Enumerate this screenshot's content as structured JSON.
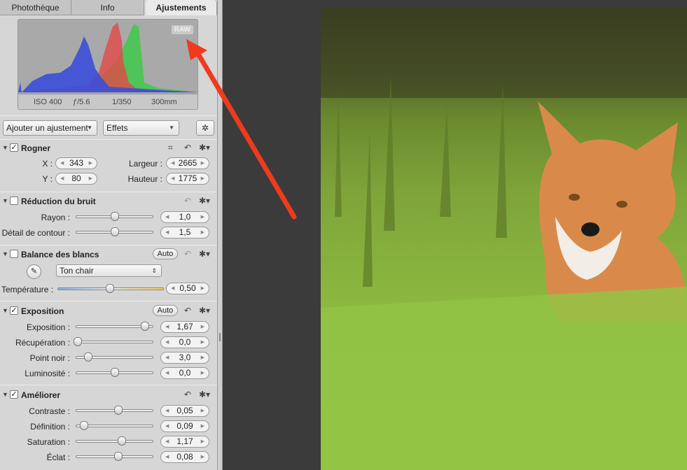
{
  "tabs": [
    {
      "label": "Photothèque"
    },
    {
      "label": "Info"
    },
    {
      "label": "Ajustements",
      "active": true
    }
  ],
  "histogram": {
    "badge": "RAW",
    "iso": "ISO 400",
    "aperture": "ƒ/5.6",
    "shutter": "1/350",
    "focal": "300mm"
  },
  "toolbar": {
    "add_adjustment": "Ajouter un ajustement",
    "effects": "Effets",
    "magic_icon": "magic-wand-icon"
  },
  "crop": {
    "title": "Rogner",
    "checked": true,
    "x_label": "X :",
    "x": "343",
    "y_label": "Y :",
    "y": "80",
    "width_label": "Largeur :",
    "width": "2665",
    "height_label": "Hauteur :",
    "height": "1775"
  },
  "noise": {
    "title": "Réduction du bruit",
    "checked": false,
    "rows": [
      {
        "label": "Rayon :",
        "value": "1,0",
        "level": 0.5
      },
      {
        "label": "Détail de contour :",
        "value": "1,5",
        "level": 0.5
      }
    ]
  },
  "whitebalance": {
    "title": "Balance des blancs",
    "checked": false,
    "auto": "Auto",
    "preset": "Ton chair",
    "temp_label": "Température :",
    "temp_value": "0,50",
    "temp_level": 0.49
  },
  "exposure": {
    "title": "Exposition",
    "checked": true,
    "auto": "Auto",
    "rows": [
      {
        "label": "Exposition :",
        "value": "1,67",
        "level": 0.9
      },
      {
        "label": "Récupération :",
        "value": "0,0",
        "level": 0.02
      },
      {
        "label": "Point noir :",
        "value": "3,0",
        "level": 0.16
      },
      {
        "label": "Luminosité :",
        "value": "0,0",
        "level": 0.5
      }
    ]
  },
  "enhance": {
    "title": "Améliorer",
    "checked": true,
    "rows": [
      {
        "label": "Contraste :",
        "value": "0,05",
        "level": 0.55
      },
      {
        "label": "Définition :",
        "value": "0,09",
        "level": 0.1
      },
      {
        "label": "Saturation :",
        "value": "1,17",
        "level": 0.6
      },
      {
        "label": "Éclat :",
        "value": "0,08",
        "level": 0.55
      }
    ]
  },
  "colors": {
    "arrow": "#f03a1e",
    "panel": "#d6d6d6",
    "viewer": "#3b3b3b"
  }
}
